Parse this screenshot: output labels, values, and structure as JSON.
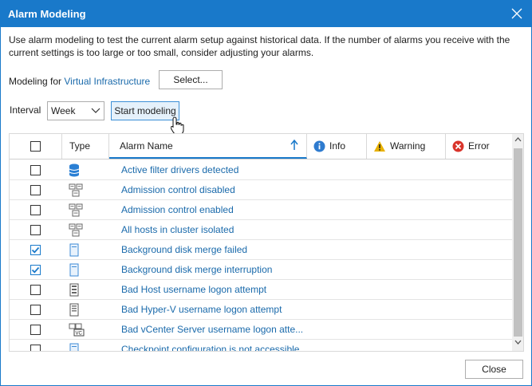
{
  "window": {
    "title": "Alarm Modeling"
  },
  "description": "Use alarm modeling to test the current alarm setup against historical data. If the number of alarms you receive with the current settings is too large or too small, consider adjusting your alarms.",
  "modeling": {
    "label": "Modeling for",
    "target": "Virtual Infrastructure",
    "select_label": "Select..."
  },
  "interval": {
    "label": "Interval",
    "value": "Week"
  },
  "start_label": "Start modeling",
  "grid": {
    "headers": {
      "type": "Type",
      "name": "Alarm Name",
      "info": "Info",
      "warning": "Warning",
      "error": "Error"
    },
    "sort": "ascending",
    "rows": [
      {
        "name": "Active filter drivers detected",
        "checked": false,
        "icon": "database-icon"
      },
      {
        "name": "Admission control disabled",
        "checked": false,
        "icon": "cluster-icon"
      },
      {
        "name": "Admission control enabled",
        "checked": false,
        "icon": "cluster-icon"
      },
      {
        "name": "All hosts in cluster isolated",
        "checked": false,
        "icon": "cluster-icon"
      },
      {
        "name": "Background disk merge failed",
        "checked": true,
        "icon": "vm-icon"
      },
      {
        "name": "Background disk merge interruption",
        "checked": true,
        "icon": "vm-icon"
      },
      {
        "name": "Bad Host username logon attempt",
        "checked": false,
        "icon": "host-icon"
      },
      {
        "name": "Bad Hyper-V username logon attempt",
        "checked": false,
        "icon": "hyperv-host-icon"
      },
      {
        "name": "Bad vCenter Server username logon atte...",
        "checked": false,
        "icon": "vcenter-icon"
      },
      {
        "name": "Checkpoint configuration is not accessible",
        "checked": false,
        "icon": "vm-icon"
      }
    ]
  },
  "close_label": "Close",
  "colors": {
    "accent": "#1979ca",
    "link": "#1a6aab",
    "info": "#2e7bcf",
    "warning": "#e8b100",
    "error": "#d9342b"
  }
}
